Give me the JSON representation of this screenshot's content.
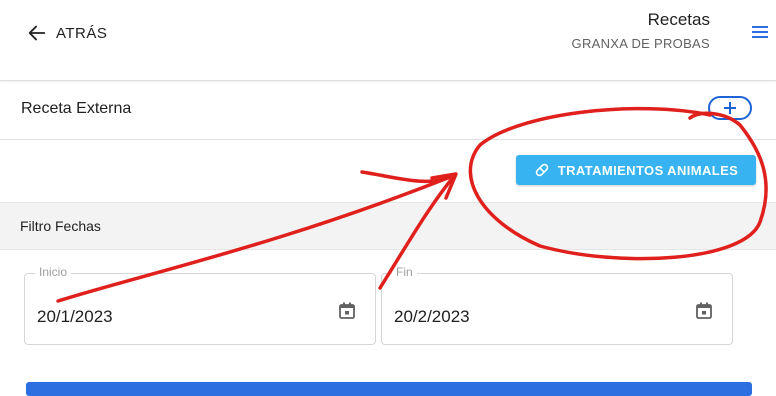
{
  "header": {
    "back_label": "ATRÁS",
    "title": "Recetas",
    "subtitle": "GRANXA DE PROBAS"
  },
  "section": {
    "label": "Receta Externa"
  },
  "actions": {
    "treatments_label": "TRATAMIENTOS ANIMALES"
  },
  "filter": {
    "label": "Filtro Fechas",
    "start": {
      "label": "Inicio",
      "value": "20/1/2023"
    },
    "end": {
      "label": "Fin",
      "value": "20/2/2023"
    }
  },
  "colors": {
    "primary": "#2d6fe0",
    "accent": "#36b3f0",
    "annotation": "#e0201c"
  },
  "icons": {
    "back": "arrow-left-icon",
    "menu": "hamburger-menu-icon",
    "add": "plus-icon",
    "treatments": "pill-icon",
    "calendar": "calendar-icon"
  }
}
